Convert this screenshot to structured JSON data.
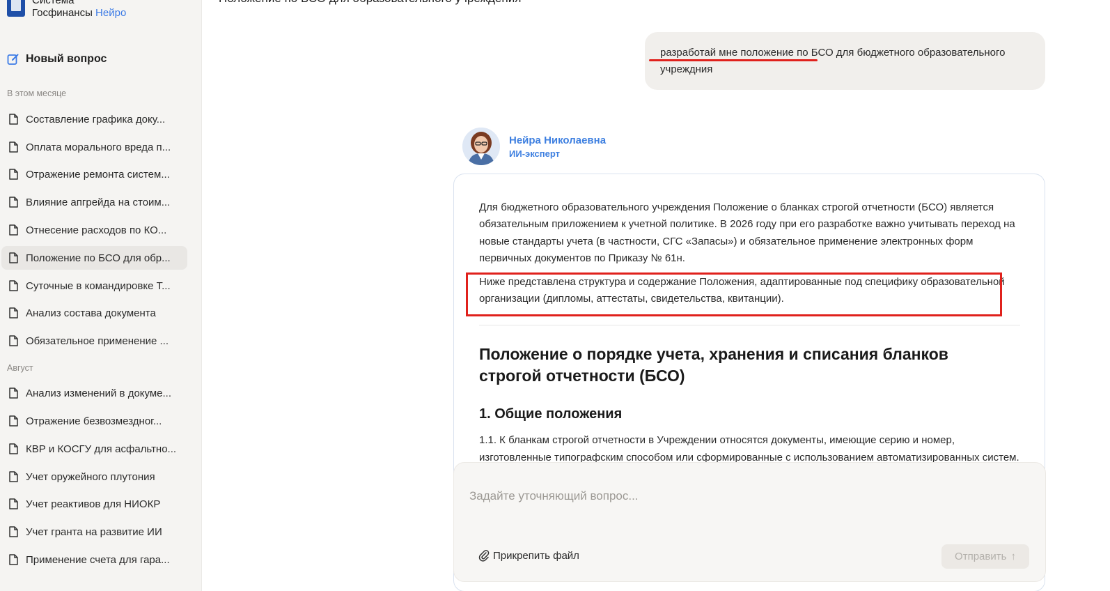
{
  "brand": {
    "line1": "Система",
    "line2_main": "Госфинансы",
    "line2_accent": "Нейро"
  },
  "sidebar": {
    "new_question": "Новый вопрос",
    "sections": [
      {
        "label": "В этом месяце",
        "items": [
          "Составление графика доку...",
          "Оплата морального вреда п...",
          "Отражение ремонта систем...",
          "Влияние апгрейда на стоим...",
          "Отнесение расходов по КО...",
          "Положение по БСО для обр...",
          "Суточные в командировке Т...",
          "Анализ состава документа",
          "Обязательное применение ..."
        ]
      },
      {
        "label": "Август",
        "items": [
          "Анализ изменений в докуме...",
          "Отражение безвозмездног...",
          "КВР и КОСГУ для асфальтно...",
          "Учет оружейного плутония",
          "Учет реактивов для НИОКР",
          "Учет гранта на развитие ИИ",
          "Применение счета для гара..."
        ]
      }
    ]
  },
  "main": {
    "page_title": "Положение по БСО для образовательного учреждения",
    "user_message": "разработай мне положение по БСО для бюджетного образовательного учреждния",
    "assistant": {
      "name": "Нейра Николаевна",
      "role": "ИИ-эксперт"
    },
    "answer": {
      "p1": "Для бюджетного образовательного учреждения Положение о бланках строгой отчетности (БСО) является обязательным приложением к учетной политике. В 2026 году при его разработке важно учитывать переход на новые стандарты учета (в частности, СГС «Запасы») и обязательное применение электронных форм первичных документов по Приказу № 61н.",
      "p2": "Ниже представлена структура и содержание Положения, адаптированные под специфику образовательной организации (дипломы, аттестаты, свидетельства, квитанции).",
      "heading": "Положение о порядке учета, хранения и списания бланков строгой отчетности (БСО)",
      "subheading": "1. Общие положения",
      "p3": "1.1. К бланкам строгой отчетности в Учреждении относятся документы, имеющие серию и номер, изготовленные типографским способом или сформированные с использованием автоматизированных систем."
    }
  },
  "composer": {
    "placeholder": "Задайте уточняющий вопрос...",
    "attach_label": "Прикрепить файл",
    "send_label": "Отправить",
    "send_arrow": "↑"
  },
  "colors": {
    "accent": "#3d7fe0",
    "highlight": "#e0211c",
    "sidebar_bg": "#f5f4f2"
  }
}
